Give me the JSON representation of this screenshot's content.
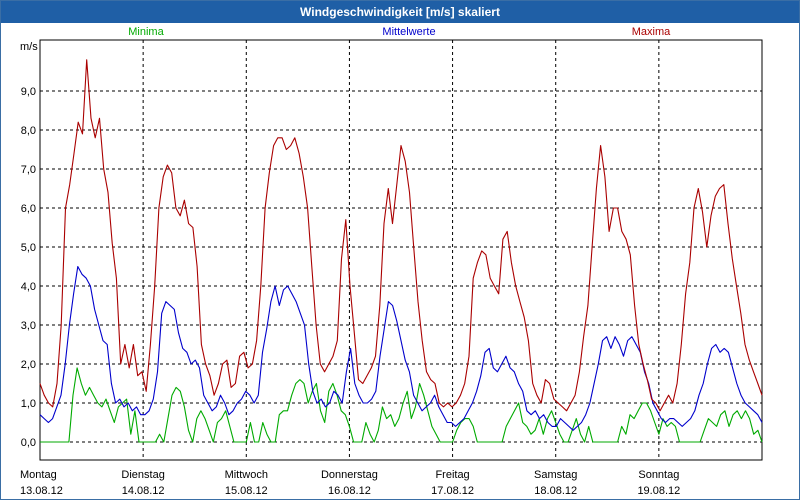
{
  "window": {
    "title": "Windgeschwindigkeit [m/s] skaliert"
  },
  "colors": {
    "minima": "#00aa00",
    "mittelwerte": "#0000cc",
    "maxima": "#aa0000",
    "grid": "#000000",
    "titlebar": "#1f5fa6"
  },
  "chart_data": {
    "type": "line",
    "title": "Windgeschwindigkeit [m/s] skaliert",
    "ylabel": "m/s",
    "ylim": [
      0,
      10
    ],
    "y_ticks": [
      "0,0",
      "1,0",
      "2,0",
      "3,0",
      "4,0",
      "5,0",
      "6,0",
      "7,0",
      "8,0",
      "9,0"
    ],
    "x_days": [
      {
        "day": "Montag",
        "date": "13.08.12"
      },
      {
        "day": "Dienstag",
        "date": "14.08.12"
      },
      {
        "day": "Mittwoch",
        "date": "15.08.12"
      },
      {
        "day": "Donnerstag",
        "date": "16.08.12"
      },
      {
        "day": "Freitag",
        "date": "17.08.12"
      },
      {
        "day": "Samstag",
        "date": "18.08.12"
      },
      {
        "day": "Sonntag",
        "date": "19.08.12"
      }
    ],
    "series": [
      {
        "name": "Minima",
        "color": "#00aa00",
        "values": [
          0,
          0,
          0,
          0,
          0,
          0,
          0,
          0,
          1.2,
          1.9,
          1.5,
          1.2,
          1.4,
          1.2,
          1.0,
          0.9,
          1.1,
          0.8,
          0.5,
          0.9,
          1.0,
          1.1,
          0.2,
          0.8,
          0,
          0,
          0,
          0,
          0,
          0.2,
          0,
          0.6,
          1.2,
          1.4,
          1.3,
          0.9,
          0.3,
          0,
          0.6,
          0.8,
          0.6,
          0.3,
          0,
          0.5,
          0.6,
          0.8,
          0.4,
          0,
          0,
          0,
          0,
          0.5,
          0,
          0,
          0.5,
          0.2,
          0,
          0,
          0.7,
          0.8,
          0.8,
          1.2,
          1.5,
          1.6,
          1.5,
          1.0,
          1.3,
          1.5,
          0.8,
          0.5,
          1.3,
          1.5,
          1.2,
          0.8,
          0.7,
          0.4,
          0,
          0,
          0,
          0.5,
          0.2,
          0,
          0.3,
          0.9,
          0.6,
          0.7,
          0.4,
          0.6,
          1.0,
          1.3,
          0.6,
          0.9,
          1.5,
          1.2,
          0.8,
          0.4,
          0.2,
          0,
          0,
          0,
          0,
          0.3,
          0.5,
          0.6,
          0.6,
          0.4,
          0,
          0,
          0,
          0,
          0,
          0,
          0,
          0.4,
          0.6,
          0.8,
          1.0,
          0.5,
          0.4,
          0.2,
          0.3,
          0.6,
          0.2,
          0.6,
          0.8,
          0.5,
          0.2,
          0,
          0,
          0.3,
          0.6,
          0.2,
          0,
          0.4,
          0,
          0,
          0,
          0,
          0,
          0,
          0,
          0.4,
          0.2,
          0.7,
          0.6,
          0.8,
          1.0,
          1.0,
          0.8,
          0.5,
          0.2,
          0.6,
          0.4,
          0.5,
          0.4,
          0,
          0,
          0,
          0,
          0,
          0,
          0.3,
          0.6,
          0.5,
          0.4,
          0.7,
          0.8,
          0.4,
          0.7,
          0.8,
          0.6,
          0.8,
          0.6,
          0.2,
          0.3,
          0
        ]
      },
      {
        "name": "Mittelwerte",
        "color": "#0000cc",
        "values": [
          0.7,
          0.6,
          0.5,
          0.6,
          0.9,
          1.2,
          2.0,
          3.0,
          3.8,
          4.5,
          4.3,
          4.2,
          4.0,
          3.4,
          3.0,
          2.6,
          2.5,
          1.5,
          1.0,
          1.1,
          0.9,
          1.0,
          0.8,
          0.9,
          0.7,
          0.7,
          0.8,
          1.1,
          1.8,
          3.3,
          3.6,
          3.5,
          3.4,
          2.8,
          2.4,
          2.3,
          2.0,
          2.1,
          1.9,
          1.2,
          1.0,
          0.8,
          0.9,
          1.2,
          1.0,
          0.7,
          0.8,
          1.0,
          1.1,
          1.3,
          1.2,
          1.0,
          1.2,
          2.3,
          2.9,
          3.6,
          4.0,
          3.5,
          3.9,
          4.0,
          3.8,
          3.6,
          3.3,
          3.0,
          2.0,
          1.3,
          1.0,
          1.1,
          0.9,
          1.0,
          1.3,
          1.2,
          1.0,
          1.8,
          2.4,
          1.5,
          1.2,
          1.0,
          1.0,
          1.1,
          1.3,
          2.2,
          2.9,
          3.6,
          3.5,
          3.1,
          2.6,
          2.1,
          1.8,
          1.2,
          1.0,
          0.8,
          0.9,
          1.0,
          1.2,
          0.9,
          0.7,
          0.5,
          0.5,
          0.4,
          0.5,
          0.6,
          0.8,
          1.0,
          1.3,
          1.7,
          2.3,
          2.4,
          1.9,
          1.8,
          2.0,
          2.2,
          1.9,
          1.8,
          1.5,
          1.3,
          0.8,
          0.7,
          0.8,
          0.6,
          0.7,
          0.5,
          0.4,
          0.4,
          0.6,
          0.5,
          0.4,
          0.3,
          0.4,
          0.5,
          0.7,
          1.0,
          1.5,
          2.0,
          2.6,
          2.7,
          2.4,
          2.7,
          2.5,
          2.2,
          2.6,
          2.7,
          2.5,
          2.3,
          1.8,
          1.5,
          1.0,
          0.8,
          0.6,
          0.5,
          0.6,
          0.6,
          0.5,
          0.4,
          0.5,
          0.6,
          0.8,
          1.2,
          1.5,
          2.0,
          2.4,
          2.5,
          2.3,
          2.4,
          2.3,
          1.9,
          1.5,
          1.2,
          1.0,
          0.9,
          0.8,
          0.7,
          0.5
        ]
      },
      {
        "name": "Maxima",
        "color": "#aa0000",
        "values": [
          1.5,
          1.2,
          1.0,
          0.9,
          1.5,
          3.0,
          6.0,
          6.6,
          7.4,
          8.2,
          7.9,
          9.8,
          8.3,
          7.8,
          8.3,
          7.0,
          6.4,
          5.1,
          4.2,
          2.0,
          2.5,
          1.9,
          2.5,
          1.7,
          1.8,
          1.3,
          2.5,
          4.0,
          6.0,
          6.8,
          7.1,
          6.9,
          6.0,
          5.8,
          6.2,
          5.6,
          5.5,
          4.5,
          2.5,
          2.0,
          1.7,
          1.2,
          1.5,
          2.0,
          2.1,
          1.4,
          1.5,
          2.2,
          2.3,
          1.9,
          2.0,
          2.6,
          4.0,
          6.0,
          6.9,
          7.6,
          7.8,
          7.8,
          7.5,
          7.6,
          7.8,
          7.4,
          6.8,
          6.0,
          4.5,
          3.0,
          2.0,
          1.8,
          2.0,
          2.2,
          2.6,
          4.7,
          5.7,
          4.0,
          2.8,
          1.6,
          1.5,
          1.7,
          1.9,
          2.2,
          3.5,
          5.6,
          6.5,
          5.6,
          6.6,
          7.6,
          7.2,
          6.4,
          5.0,
          3.6,
          2.6,
          1.8,
          1.6,
          1.5,
          1.0,
          0.9,
          1.0,
          0.9,
          1.0,
          1.2,
          1.5,
          2.2,
          4.2,
          4.6,
          4.9,
          4.8,
          4.2,
          4.0,
          3.8,
          5.2,
          5.4,
          4.6,
          4.0,
          3.6,
          3.2,
          2.6,
          1.5,
          1.2,
          1.0,
          1.6,
          1.5,
          1.1,
          1.0,
          0.9,
          0.8,
          1.0,
          1.2,
          1.8,
          2.7,
          3.5,
          5.0,
          6.5,
          7.6,
          6.8,
          5.4,
          6.0,
          6.0,
          5.4,
          5.2,
          4.8,
          3.5,
          2.5,
          2.0,
          1.6,
          1.1,
          1.0,
          0.8,
          1.0,
          1.2,
          1.0,
          1.5,
          2.5,
          3.8,
          4.6,
          6.0,
          6.5,
          5.9,
          5.0,
          5.8,
          6.3,
          6.5,
          6.6,
          5.6,
          4.7,
          4.0,
          3.3,
          2.5,
          2.1,
          1.8,
          1.5,
          1.2
        ]
      }
    ],
    "legend": [
      "Minima",
      "Mittelwerte",
      "Maxima"
    ],
    "grid": true
  }
}
